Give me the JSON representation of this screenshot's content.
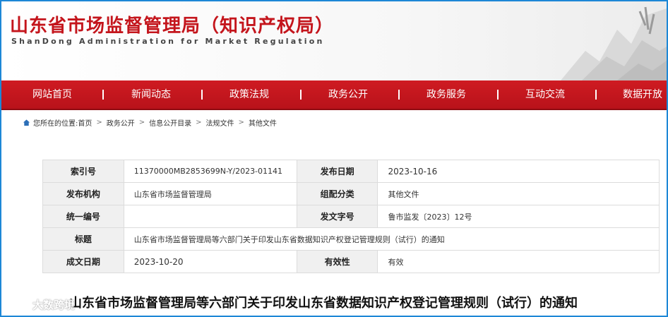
{
  "header": {
    "title": "山东省市场监督管理局（知识产权局）",
    "subtitle": "ShanDong Administration for Market Regulation"
  },
  "nav": {
    "items": [
      {
        "label": "网站首页"
      },
      {
        "label": "新闻动态"
      },
      {
        "label": "政策法规"
      },
      {
        "label": "政务公开"
      },
      {
        "label": "政务服务"
      },
      {
        "label": "互动交流"
      },
      {
        "label": "数据开放"
      }
    ]
  },
  "breadcrumb": {
    "prefix": "您所在的位置:",
    "items": [
      "首页",
      "政务公开",
      "信息公开目录",
      "法规文件",
      "其他文件"
    ],
    "separator": ">"
  },
  "info_table": {
    "rows": [
      {
        "l1": "索引号",
        "v1": "11370000MB2853699N-Y/2023-01141",
        "l2": "发布日期",
        "v2": "2023-10-16"
      },
      {
        "l1": "发布机构",
        "v1": "山东省市场监督管理局",
        "l2": "组配分类",
        "v2": "其他文件"
      },
      {
        "l1": "统一编号",
        "v1": "",
        "l2": "发文字号",
        "v2": "鲁市监发〔2023〕12号"
      },
      {
        "l1": "标题",
        "v1": "山东省市场监督管理局等六部门关于印发山东省数据知识产权登记管理规则（试行）的通知"
      },
      {
        "l1": "成文日期",
        "v1": "2023-10-20",
        "l2": "有效性",
        "v2": "有效"
      }
    ]
  },
  "document": {
    "title": "山东省市场监督管理局等六部门关于印发山东省数据知识产权登记管理规则（试行）的通知"
  },
  "watermark": {
    "text": "大数跨境"
  },
  "colors": {
    "brand_red": "#c4151c",
    "nav_red": "#c4151c",
    "frame_blue": "#1d87d6"
  }
}
